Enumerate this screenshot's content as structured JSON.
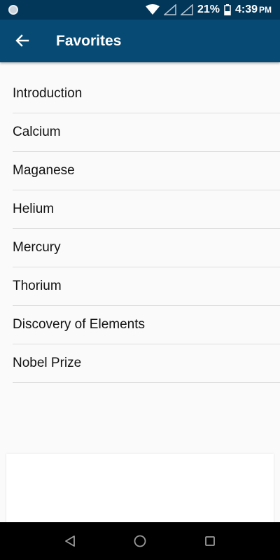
{
  "status_bar": {
    "battery": "21%",
    "time": "4:39",
    "ampm": "PM"
  },
  "app_bar": {
    "title": "Favorites",
    "back_icon": "arrow-left-icon"
  },
  "favorites": [
    {
      "label": "Introduction"
    },
    {
      "label": "Calcium"
    },
    {
      "label": "Maganese"
    },
    {
      "label": "Helium"
    },
    {
      "label": "Mercury"
    },
    {
      "label": "Thorium"
    },
    {
      "label": "Discovery of Elements"
    },
    {
      "label": "Nobel Prize"
    }
  ],
  "nav_bar": {
    "back": "triangle-back-icon",
    "home": "circle-home-icon",
    "recents": "square-recents-icon"
  },
  "colors": {
    "status_bar": "#03375a",
    "app_bar": "#074a73",
    "background": "#fafafa"
  }
}
